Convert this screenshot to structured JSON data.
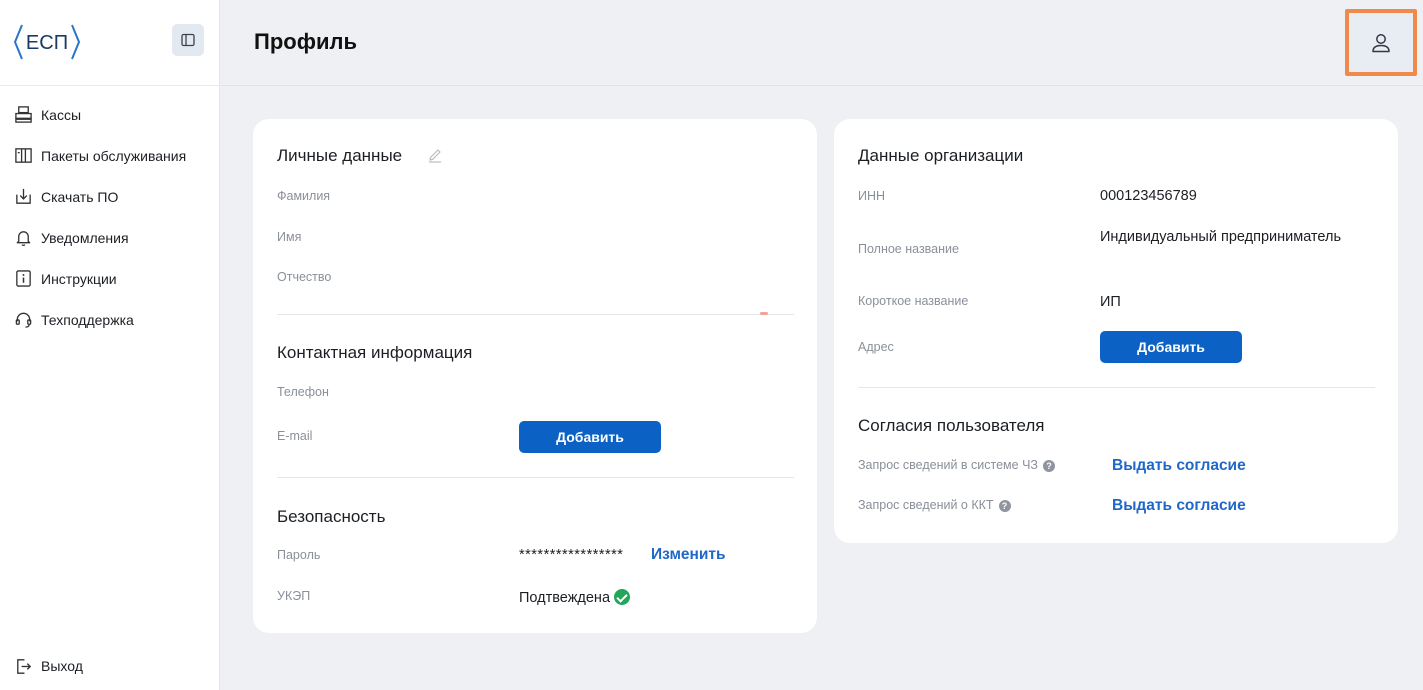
{
  "sidebar": {
    "logo_text": "ЕСП",
    "items": [
      {
        "label": "Кассы",
        "icon": "register-icon"
      },
      {
        "label": "Пакеты обслуживания",
        "icon": "package-icon"
      },
      {
        "label": "Скачать ПО",
        "icon": "download-icon"
      },
      {
        "label": "Уведомления",
        "icon": "bell-icon"
      },
      {
        "label": "Инструкции",
        "icon": "info-icon"
      },
      {
        "label": "Техподдержка",
        "icon": "headset-icon"
      }
    ],
    "logout_label": "Выход"
  },
  "header": {
    "title": "Профиль"
  },
  "personal": {
    "title": "Личные данные",
    "surname_label": "Фамилия",
    "name_label": "Имя",
    "patronymic_label": "Отчество"
  },
  "contacts": {
    "title": "Контактная информация",
    "phone_label": "Телефон",
    "email_label": "E-mail",
    "add_button": "Добавить"
  },
  "security": {
    "title": "Безопасность",
    "password_label": "Пароль",
    "password_value": "*****************",
    "change_link": "Изменить",
    "ukep_label": "УКЭП",
    "ukep_value": "Подтвеждена"
  },
  "organization": {
    "title": "Данные организации",
    "inn_label": "ИНН",
    "inn_value": "000123456789",
    "full_name_label": "Полное название",
    "full_name_value": "Индивидуальный предприниматель",
    "short_name_label": "Короткое название",
    "short_name_value": "ИП",
    "address_label": "Адрес",
    "add_button": "Добавить"
  },
  "consents": {
    "title": "Согласия пользователя",
    "chz_label": "Запрос сведений в системе ЧЗ",
    "kkt_label": "Запрос сведений о ККТ",
    "grant_link": "Выдать согласие"
  },
  "colors": {
    "primary": "#0b62c4",
    "link": "#1f68c9",
    "highlight": "#f08a4b",
    "success": "#21a65a",
    "background": "#eef0f3"
  }
}
